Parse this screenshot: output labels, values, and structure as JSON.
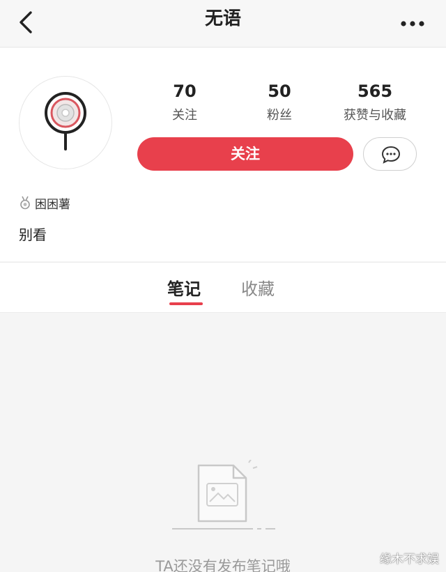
{
  "navbar": {
    "title": "无语",
    "back_icon": "chevron-left-icon",
    "more_icon": "more-dots-icon"
  },
  "profile": {
    "avatar_icon": "magnifier-avatar",
    "stats": [
      {
        "value": "70",
        "label": "关注"
      },
      {
        "value": "50",
        "label": "粉丝"
      },
      {
        "value": "565",
        "label": "获赞与收藏"
      }
    ],
    "follow_label": "关注",
    "message_icon": "chat-bubble-icon",
    "badge_icon": "medal-icon",
    "badge_label": "困困薯",
    "bio": "别看"
  },
  "tabs": [
    {
      "label": "笔记",
      "active": true
    },
    {
      "label": "收藏",
      "active": false
    }
  ],
  "empty_state": {
    "icon": "empty-document-icon",
    "message": "TA还没有发布笔记哦"
  },
  "watermark": "缘木不求娱",
  "colors": {
    "accent": "#e8404c",
    "page_background": "#f5f5f5",
    "card_background": "#ffffff"
  }
}
